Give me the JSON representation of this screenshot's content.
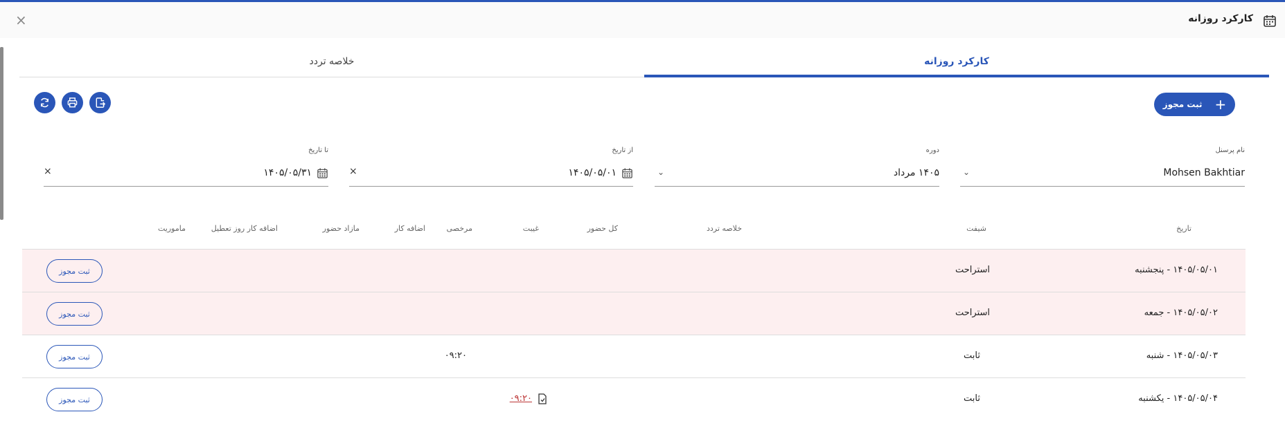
{
  "window": {
    "title": "کارکرد روزانه",
    "close_symbol": "×"
  },
  "tabs": [
    {
      "label": "کارکرد روزانه"
    },
    {
      "label": "خلاصه تردد"
    }
  ],
  "toolbar": {
    "add_permit_label": "ثبت مجوز",
    "add_symbol": "+"
  },
  "filters": {
    "personnel": {
      "label": "نام پرسنل",
      "value": "Mohsen Bakhtiar"
    },
    "period": {
      "label": "دوره",
      "value": "۱۴۰۵ مرداد"
    },
    "from_date": {
      "label": "از تاریخ",
      "value": "۱۴۰۵/۰۵/۰۱"
    },
    "to_date": {
      "label": "تا تاریخ",
      "value": "۱۴۰۵/۰۵/۳۱"
    },
    "clear_symbol": "×"
  },
  "table": {
    "columns": [
      "تاریخ",
      "شیفت",
      "خلاصه تردد",
      "کل حضور",
      "غیبت",
      "مرخصی",
      "اضافه کار",
      "مازاد حضور",
      "اضافه کار روز تعطیل",
      "ماموریت"
    ],
    "rows": [
      {
        "date": "۱۴۰۵/۰۵/۰۱ - پنجشنبه",
        "shift": "استراحت",
        "absence": "",
        "leave": "",
        "action": "ثبت مجوز"
      },
      {
        "date": "۱۴۰۵/۰۵/۰۲ - جمعه",
        "shift": "استراحت",
        "absence": "",
        "leave": "",
        "action": "ثبت مجوز"
      },
      {
        "date": "۱۴۰۵/۰۵/۰۳ - شنبه",
        "shift": "ثابت",
        "absence": "",
        "leave": "۰۹:۲۰",
        "action": "ثبت مجوز"
      },
      {
        "date": "۱۴۰۵/۰۵/۰۴ - یکشنبه",
        "shift": "ثابت",
        "absence": "۰۹:۲۰",
        "leave": "",
        "action": "ثبت مجوز"
      }
    ]
  },
  "colors": {
    "accent": "#2a56b8",
    "holiday_row": "#fdeff0",
    "absence_link": "#b33333"
  }
}
